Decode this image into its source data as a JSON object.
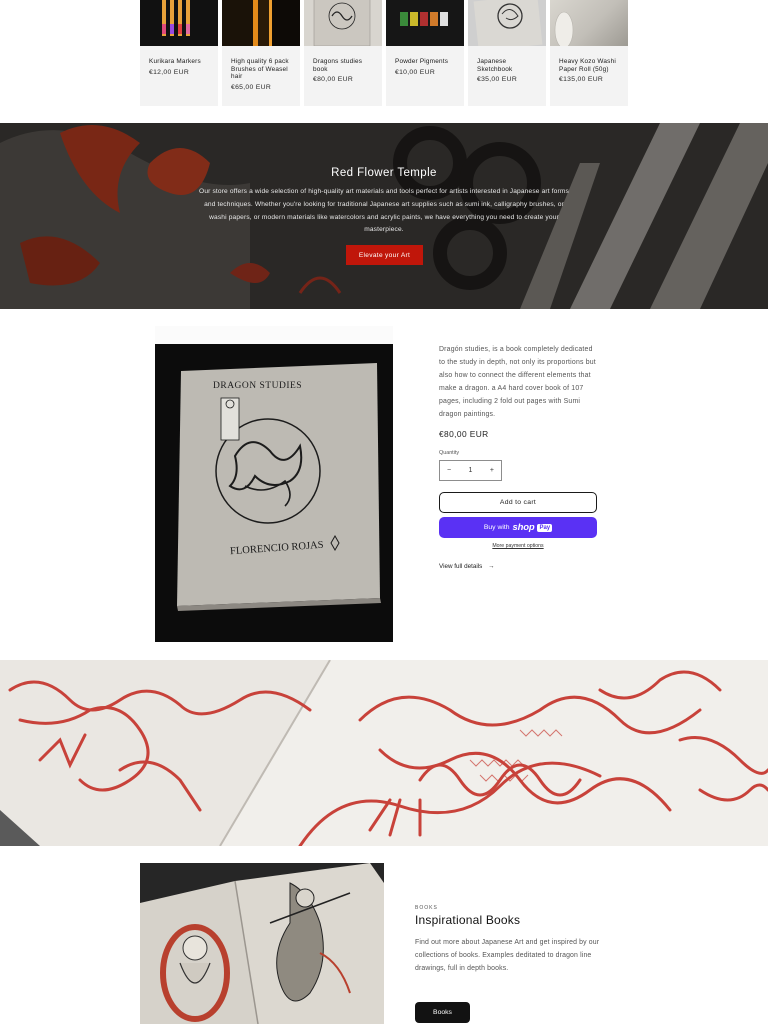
{
  "products": [
    {
      "title": "Kurikara Markers",
      "price": "€12,00 EUR"
    },
    {
      "title": "High quality 6 pack Brushes of Weasel hair",
      "price": "€65,00 EUR"
    },
    {
      "title": "Dragons studies book",
      "price": "€80,00 EUR"
    },
    {
      "title": "Powder Pigments",
      "price": "€10,00 EUR"
    },
    {
      "title": "Japanese Sketchbook",
      "price": "€35,00 EUR"
    },
    {
      "title": "Heavy Kozo Washi Paper Roll (50g)",
      "price": "€135,00 EUR"
    }
  ],
  "banner": {
    "title": "Red Flower Temple",
    "text": "Our store offers a wide selection of high-quality art materials and tools perfect for artists interested in Japanese art forms and techniques. Whether you're looking for traditional Japanese art supplies such as sumi ink, calligraphy brushes, or washi papers, or modern materials like watercolors and acrylic paints, we have everything you need to create your masterpiece.",
    "button": "Elevate your Art"
  },
  "featured": {
    "book_cover_title": "DRAGON STUDIES",
    "book_cover_author": "FLORENCIO ROJAS",
    "description": "Dragón studies, is a book completely dedicated to the study in depth, not only its proportions but also how to connect the different elements that make a dragon. a A4 hard cover book of 107 pages, including 2 fold out pages with Sumi dragon paintings.",
    "price": "€80,00 EUR",
    "quantity_label": "Quantity",
    "quantity_value": "1",
    "minus": "−",
    "plus": "+",
    "add_to_cart": "Add to cart",
    "buy_with": "Buy with",
    "shop": "shop",
    "pay": "Pay",
    "more_payment": "More payment options",
    "view_details": "View full details",
    "arrow": "→"
  },
  "books": {
    "eyebrow": "BOOKS",
    "title": "Inspirational Books",
    "description": "Find out more about Japanese Art and get inspired by our collections of books. Examples deditated to dragon line drawings, full in depth books.",
    "button": "Books"
  },
  "colors": {
    "accent_red": "#c0160a",
    "shop_pay": "#5a31f4",
    "dark": "#121212"
  }
}
